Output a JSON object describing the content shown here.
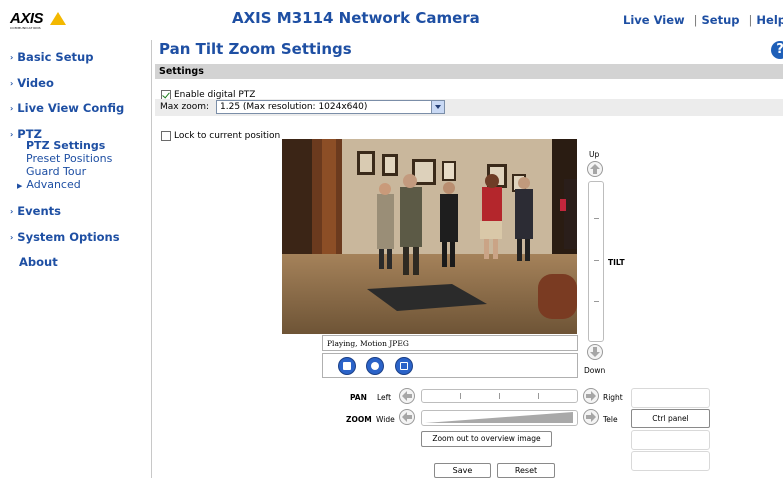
{
  "header": {
    "logo_text": "AXIS",
    "logo_sub": "COMMUNICATIONS",
    "app_title": "AXIS M3114 Network Camera",
    "nav": [
      "Live View",
      "Setup",
      "Help"
    ]
  },
  "sidebar": {
    "items": [
      {
        "label": "Basic Setup"
      },
      {
        "label": "Video"
      },
      {
        "label": "Live View Config"
      },
      {
        "label": "PTZ"
      },
      {
        "label": "Events"
      },
      {
        "label": "System Options"
      },
      {
        "label": "About"
      }
    ],
    "ptz_sub": [
      "PTZ Settings",
      "Preset Positions",
      "Guard Tour"
    ],
    "advanced": "Advanced"
  },
  "main": {
    "title": "Pan Tilt Zoom Settings",
    "help_glyph": "?",
    "section": "Settings",
    "enable_digital_ptz": {
      "label": "Enable digital PTZ",
      "checked": true
    },
    "max_zoom": {
      "label": "Max zoom:",
      "value": "1.25 (Max resolution: 1024x640)"
    },
    "lock_position": {
      "label": "Lock to current position",
      "checked": false
    },
    "video_status": "Playing, Motion JPEG",
    "tilt": {
      "up": "Up",
      "label": "TILT",
      "down": "Down"
    },
    "pan": {
      "label": "PAN",
      "left": "Left",
      "right": "Right"
    },
    "zoom": {
      "label": "ZOOM",
      "wide": "Wide",
      "tele": "Tele"
    },
    "zoom_out_button": "Zoom out to overview image",
    "ctrl_panel_button": "Ctrl panel",
    "save_button": "Save",
    "reset_button": "Reset"
  },
  "colors": {
    "link_blue": "#1e4fa3",
    "settings_bar": "#d3d3d3",
    "logo_yellow": "#f3b800"
  }
}
